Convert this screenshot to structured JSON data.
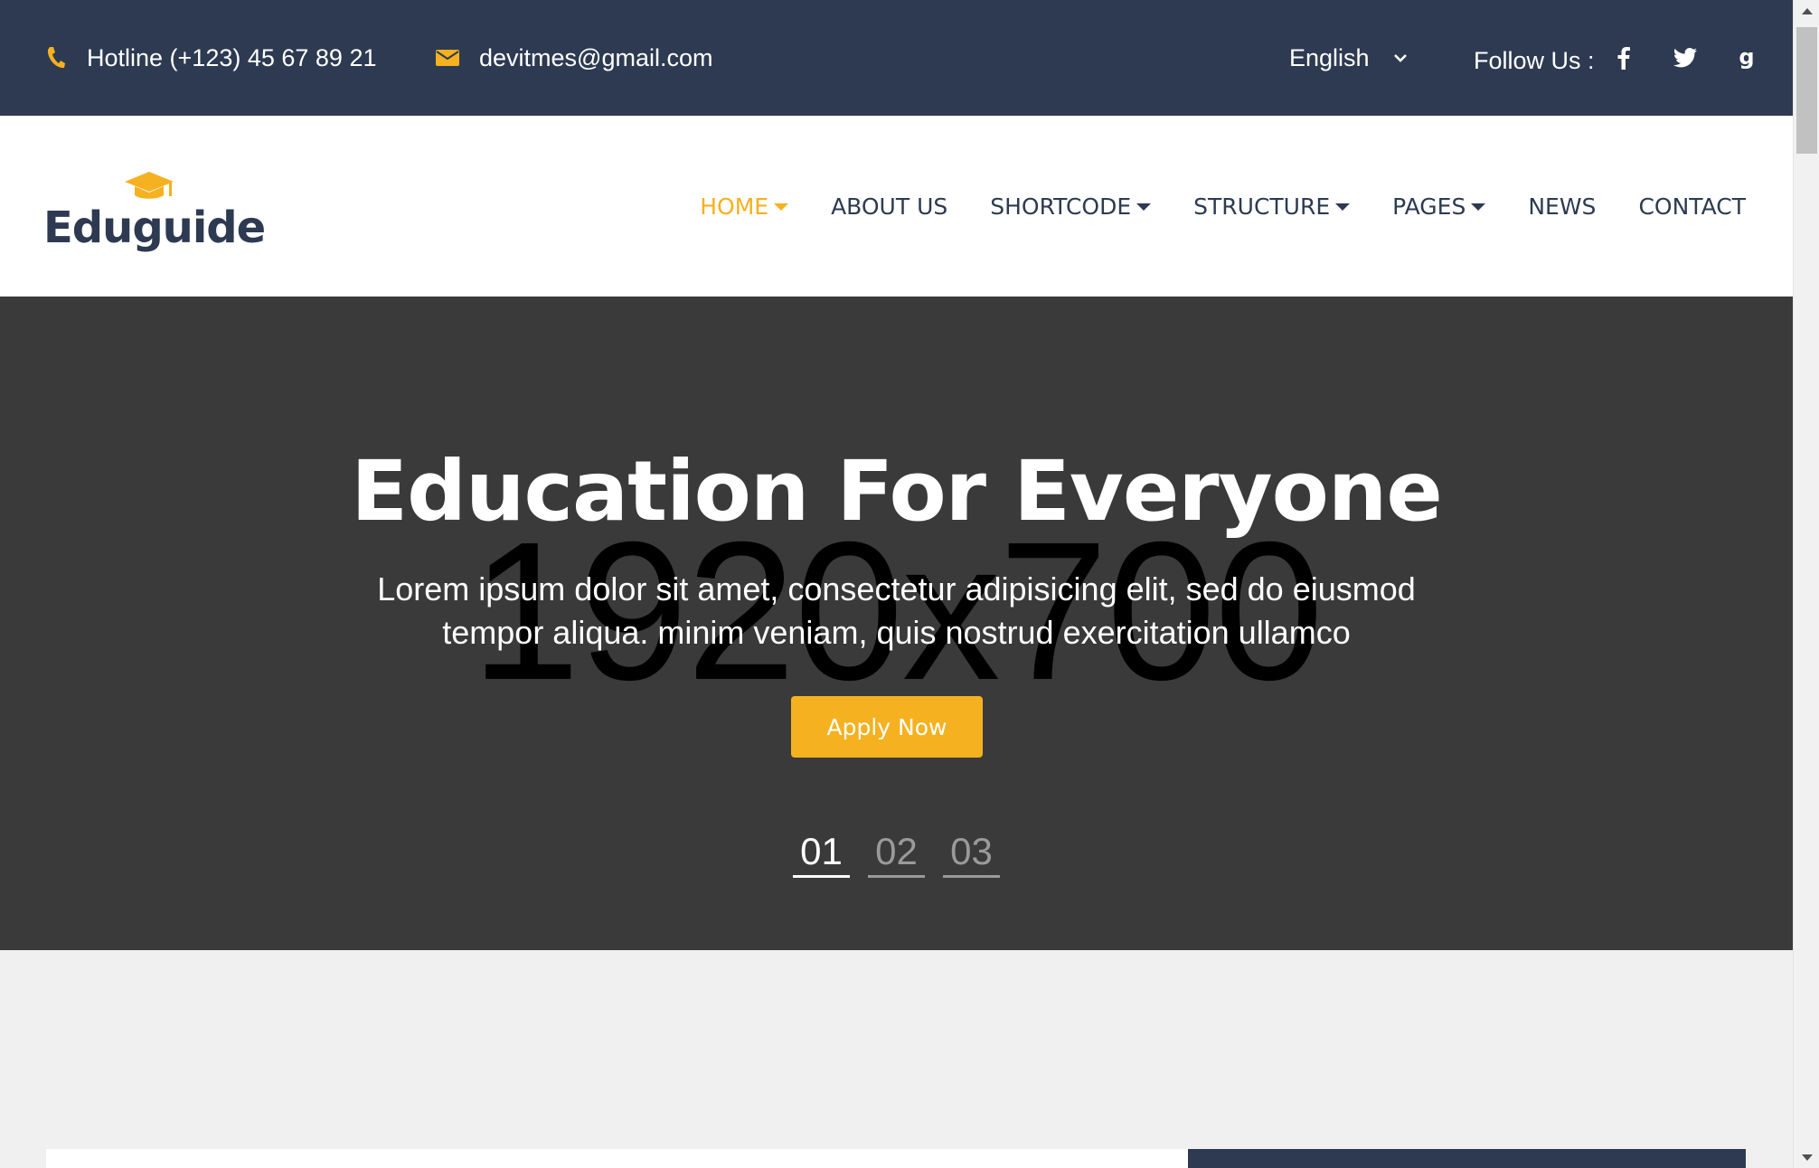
{
  "topbar": {
    "hotline": "Hotline (+123) 45 67 89 21",
    "email": "devitmes@gmail.com",
    "language": "English",
    "follow_label": "Follow Us :",
    "icons": {
      "phone": "phone-icon",
      "mail": "mail-icon",
      "language_dropdown": "chevron-down-icon",
      "social": [
        "facebook-icon",
        "twitter-icon",
        "google-icon"
      ]
    }
  },
  "header": {
    "logo_text": "Eduguide",
    "logo_icon": "graduation-cap-icon",
    "nav": [
      {
        "label": "HOME",
        "has_dropdown": true,
        "active": true
      },
      {
        "label": "ABOUT US",
        "has_dropdown": false,
        "active": false
      },
      {
        "label": "SHORTCODE",
        "has_dropdown": true,
        "active": false
      },
      {
        "label": "STRUCTURE",
        "has_dropdown": true,
        "active": false
      },
      {
        "label": "PAGES",
        "has_dropdown": true,
        "active": false
      },
      {
        "label": "NEWS",
        "has_dropdown": false,
        "active": false
      },
      {
        "label": "CONTACT",
        "has_dropdown": false,
        "active": false
      }
    ]
  },
  "hero": {
    "placeholder": "1920x700",
    "title": "Education For Everyone",
    "description": "Lorem ipsum dolor sit amet, consectetur adipisicing elit, sed do eiusmod tempor aliqua. minim veniam, quis nostrud exercitation ullamco",
    "button": "Apply Now",
    "slides": [
      "01",
      "02",
      "03"
    ],
    "active_slide": "01"
  },
  "colors": {
    "topbar_bg": "#2d3a51",
    "accent": "#f5b120",
    "hero_bg": "#3a3a3a",
    "page_bg": "#f0f0f0"
  }
}
